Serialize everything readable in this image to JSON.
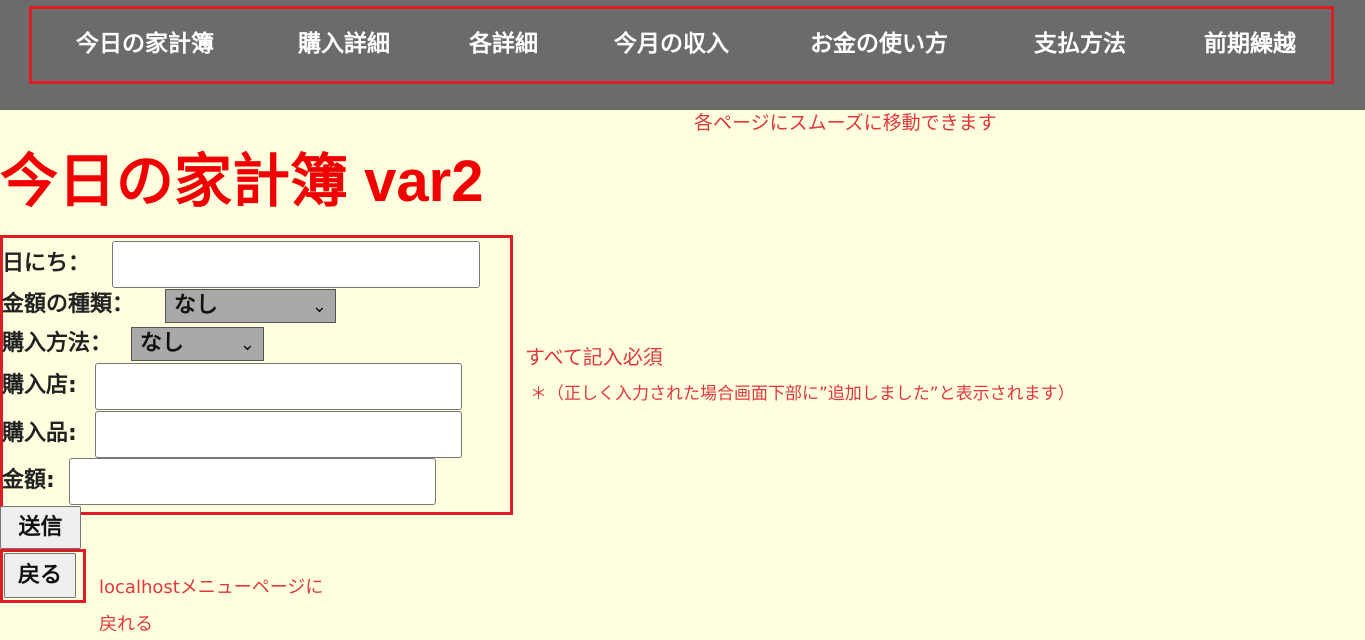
{
  "nav": {
    "items": [
      "今日の家計簿",
      "購入詳細",
      "各詳細",
      "今月の収入",
      "お金の使い方",
      "支払方法",
      "前期繰越"
    ]
  },
  "notes": {
    "nav_hint": "各ページにスムーズに移動できます",
    "required": "すべて記入必須",
    "added_info": "＊（正しく入力された場合画面下部に”追加しました”と表示されます）",
    "back_hint_line1": "localhostメニューページに",
    "back_hint_line2": "戻れる"
  },
  "page": {
    "title": "今日の家計簿 var2"
  },
  "form": {
    "date_label": "日にち：",
    "date_value": "",
    "amount_type_label": "金額の種類：",
    "amount_type_value": "なし",
    "purchase_method_label": "購入方法：",
    "purchase_method_value": "なし",
    "store_label": "購入店:",
    "store_value": "",
    "item_label": "購入品:",
    "item_value": "",
    "amount_label": "金額:",
    "amount_value": "",
    "submit_label": "送信",
    "back_label": "戻る"
  },
  "colors": {
    "nav_bg": "#6b6b6b",
    "page_bg": "#ffffe0",
    "title_red": "#f00000",
    "annotation_red": "#e01b24"
  },
  "icons": {
    "select_arrow": "chevron-down-icon"
  }
}
